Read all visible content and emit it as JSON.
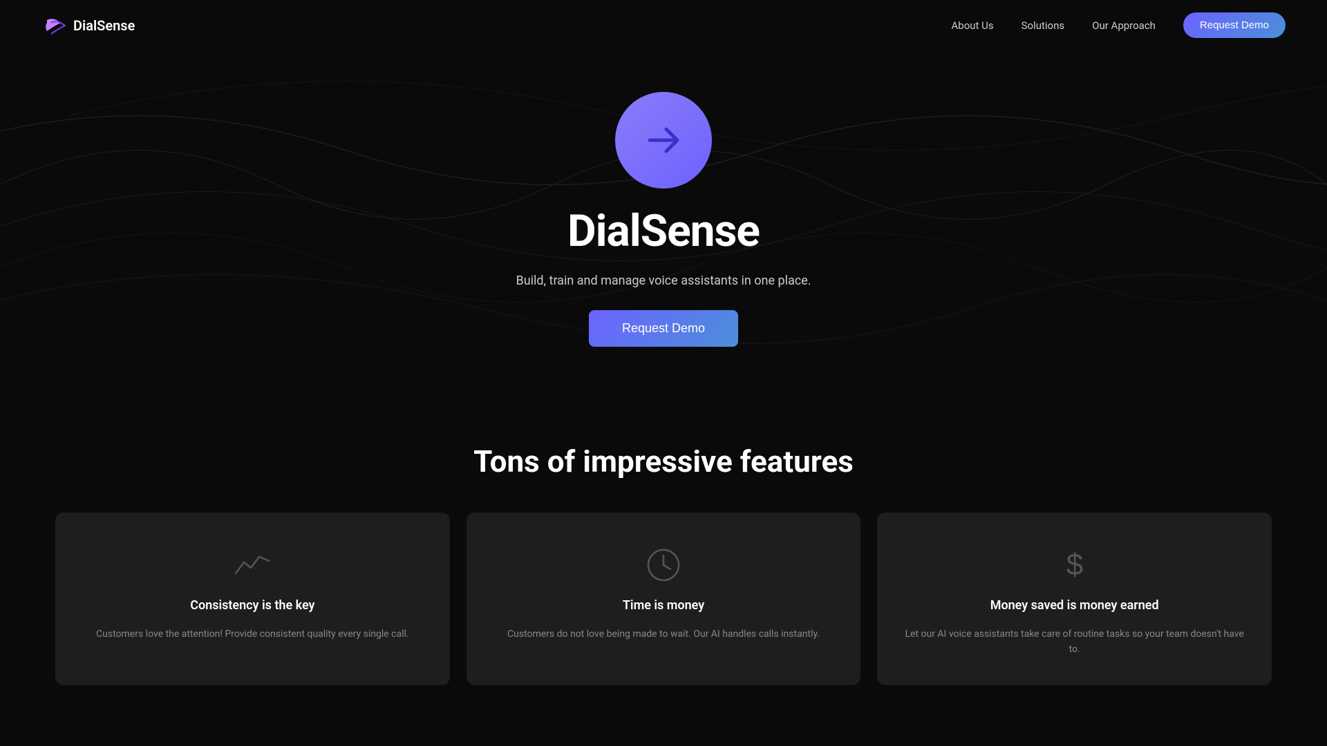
{
  "nav": {
    "logo_text": "DialSense",
    "links": [
      {
        "label": "About Us",
        "href": "#"
      },
      {
        "label": "Solutions",
        "href": "#"
      },
      {
        "label": "Our Approach",
        "href": "#"
      }
    ],
    "cta_label": "Request Demo"
  },
  "hero": {
    "title": "DialSense",
    "subtitle": "Build, train and manage voice assistants in one place.",
    "cta_label": "Request Demo"
  },
  "features": {
    "section_title": "Tons of impressive features",
    "cards": [
      {
        "title": "Consistency is the key",
        "text": "Customers love the attention! Provide consistent quality every single call.",
        "icon": "chart"
      },
      {
        "title": "Time is money",
        "text": "Customers do not love being made to wait. Our AI handles calls instantly.",
        "icon": "clock"
      },
      {
        "title": "Money saved is money earned",
        "text": "Let our AI voice assistants take care of routine tasks so your team doesn't have to.",
        "icon": "dollar"
      }
    ]
  }
}
